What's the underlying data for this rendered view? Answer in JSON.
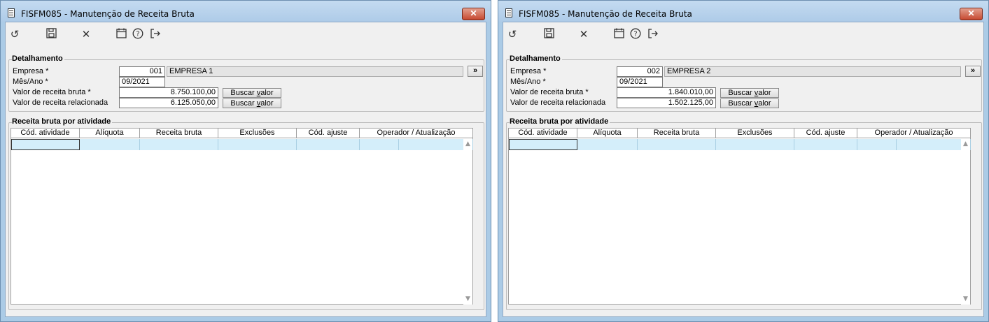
{
  "windows": [
    {
      "title": "FISFM085 - Manutenção de Receita Bruta",
      "close_symbol": "✕",
      "toolbar": {
        "icons": [
          "undo-icon",
          "save-icon",
          "cancel-icon",
          "calendar-icon",
          "help-icon",
          "exit-icon"
        ]
      },
      "detail": {
        "group_title": "Detalhamento",
        "empresa_label": "Empresa *",
        "empresa_code": "001",
        "empresa_name": "EMPRESA 1",
        "lookup_label": "»",
        "mes_ano_label": "Mês/Ano *",
        "mes_ano_value": "09/2021",
        "valor_bruta_label": "Valor de receita bruta *",
        "valor_bruta_value": "8.750.100,00",
        "valor_relacionada_label": "Valor de receita relacionada",
        "valor_relacionada_value": "6.125.050,00",
        "buscar_label_prefix": "Buscar ",
        "buscar_label_underline": "v",
        "buscar_label_suffix": "alor"
      },
      "activity": {
        "group_title": "Receita bruta por atividade",
        "columns": [
          "Cód. atividade",
          "Alíquota",
          "Receita bruta",
          "Exclusões",
          "Cód. ajuste",
          "Operador / Atualização"
        ]
      }
    },
    {
      "title": "FISFM085 - Manutenção de Receita Bruta",
      "close_symbol": "✕",
      "toolbar": {
        "icons": [
          "undo-icon",
          "save-icon",
          "cancel-icon",
          "calendar-icon",
          "help-icon",
          "exit-icon"
        ]
      },
      "detail": {
        "group_title": "Detalhamento",
        "empresa_label": "Empresa *",
        "empresa_code": "002",
        "empresa_name": "EMPRESA 2",
        "lookup_label": "»",
        "mes_ano_label": "Mês/Ano *",
        "mes_ano_value": "09/2021",
        "valor_bruta_label": "Valor de receita bruta *",
        "valor_bruta_value": "1.840.010,00",
        "valor_relacionada_label": "Valor de receita relacionada",
        "valor_relacionada_value": "1.502.125,00",
        "buscar_label_prefix": "Buscar ",
        "buscar_label_underline": "v",
        "buscar_label_suffix": "alor"
      },
      "activity": {
        "group_title": "Receita bruta por atividade",
        "columns": [
          "Cód. atividade",
          "Alíquota",
          "Receita bruta",
          "Exclusões",
          "Cód. ajuste",
          "Operador / Atualização"
        ]
      }
    }
  ]
}
